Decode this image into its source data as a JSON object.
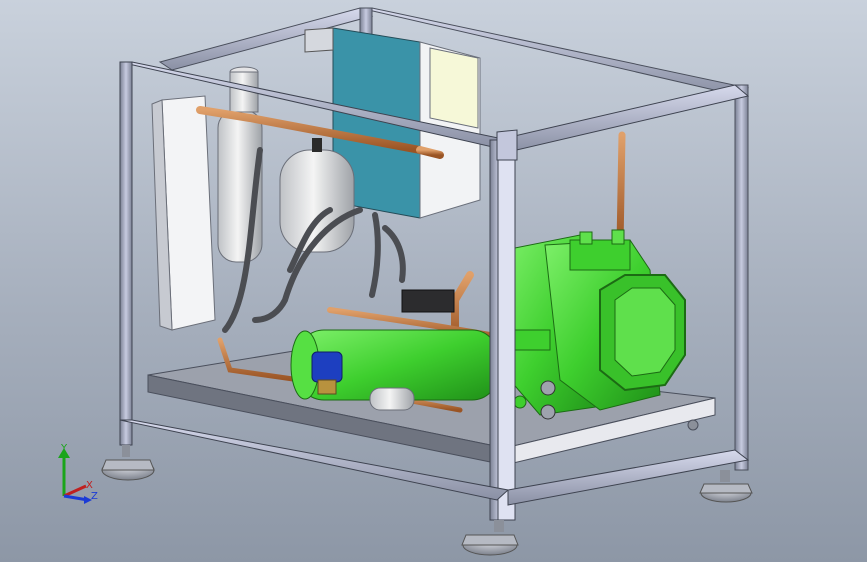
{
  "viewport": {
    "background_top": "#c9d1dc",
    "background_bottom": "#8d97a6"
  },
  "model": {
    "frame_color": "#8f95a8",
    "frame_highlight": "#cfd3e8",
    "compressor_color": "#41d631",
    "pipe_color": "#c0783f",
    "panel_color": "#3a93a8"
  },
  "triad": {
    "y_label": "Y",
    "x_label": "X",
    "z_label": "Z",
    "y_color": "#1aa51a",
    "x_color": "#c02020",
    "z_color": "#1b3bd6"
  }
}
